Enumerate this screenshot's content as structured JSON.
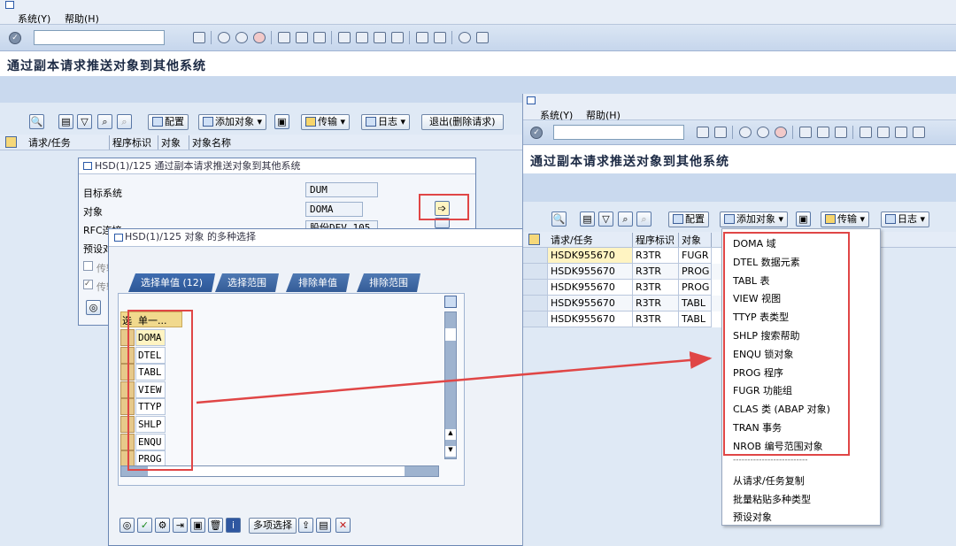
{
  "main_window": {
    "menu": {
      "system": "系统(Y)",
      "help": "帮助(H)"
    },
    "title": "通过副本请求推送对象到其他系统",
    "app_toolbar": {
      "config": "配置",
      "add_object": "添加对象",
      "transport": "传输",
      "log": "日志",
      "exit": "退出(删除请求)"
    },
    "table_headers": [
      "请求/任务",
      "程序标识",
      "对象",
      "对象名称"
    ]
  },
  "push_dialog": {
    "title": "HSD(1)/125 通过副本请求推送对象到其他系统",
    "target_system_label": "目标系统",
    "target_system_value": "DUM",
    "object_label": "对象",
    "object_value": "DOMA",
    "rfc_label": "RFC连接",
    "rfc_value": "股份DEV_105",
    "preset_label": "预设对",
    "check1_label": "传输",
    "check2_label": "传输"
  },
  "multi_select_dialog": {
    "title": "HSD(1)/125 对象 的多种选择",
    "tabs": [
      "选择单值 (12)",
      "选择范围",
      "排除单值",
      "排除范围"
    ],
    "col_select": "选",
    "col_single": "单一...",
    "values": [
      "DOMA",
      "DTEL",
      "TABL",
      "VIEW",
      "TTYP",
      "SHLP",
      "ENQU",
      "PROG"
    ],
    "multi_select_button": "多项选择"
  },
  "second_window": {
    "menu": {
      "system": "系统(Y)",
      "help": "帮助(H)"
    },
    "title": "通过副本请求推送对象到其他系统",
    "app_toolbar": {
      "config": "配置",
      "add_object": "添加对象",
      "transport": "传输",
      "log": "日志"
    },
    "table_headers": [
      "请求/任务",
      "程序标识",
      "对象"
    ],
    "rows": [
      {
        "request": "HSDK955670",
        "pgmid": "R3TR",
        "object": "FUGR"
      },
      {
        "request": "HSDK955670",
        "pgmid": "R3TR",
        "object": "PROG"
      },
      {
        "request": "HSDK955670",
        "pgmid": "R3TR",
        "object": "PROG"
      },
      {
        "request": "HSDK955670",
        "pgmid": "R3TR",
        "object": "TABL"
      },
      {
        "request": "HSDK955670",
        "pgmid": "R3TR",
        "object": "TABL"
      }
    ]
  },
  "add_object_menu": {
    "items": [
      "DOMA 域",
      "DTEL 数据元素",
      "TABL 表",
      "VIEW 视图",
      "TTYP 表类型",
      "SHLP 搜索帮助",
      "ENQU 锁对象",
      "PROG 程序",
      "FUGR 功能组",
      "CLAS 类 (ABAP 对象)",
      "TRAN 事务",
      "NROB 编号范围对象"
    ],
    "separator": "--------------------------",
    "extra_items": [
      "从请求/任务复制",
      "批量粘贴多种类型",
      "预设对象"
    ]
  },
  "colors": {
    "highlight_red": "#e04646",
    "sap_blue": "#2d5897",
    "selected_cell": "#fff4c2"
  }
}
